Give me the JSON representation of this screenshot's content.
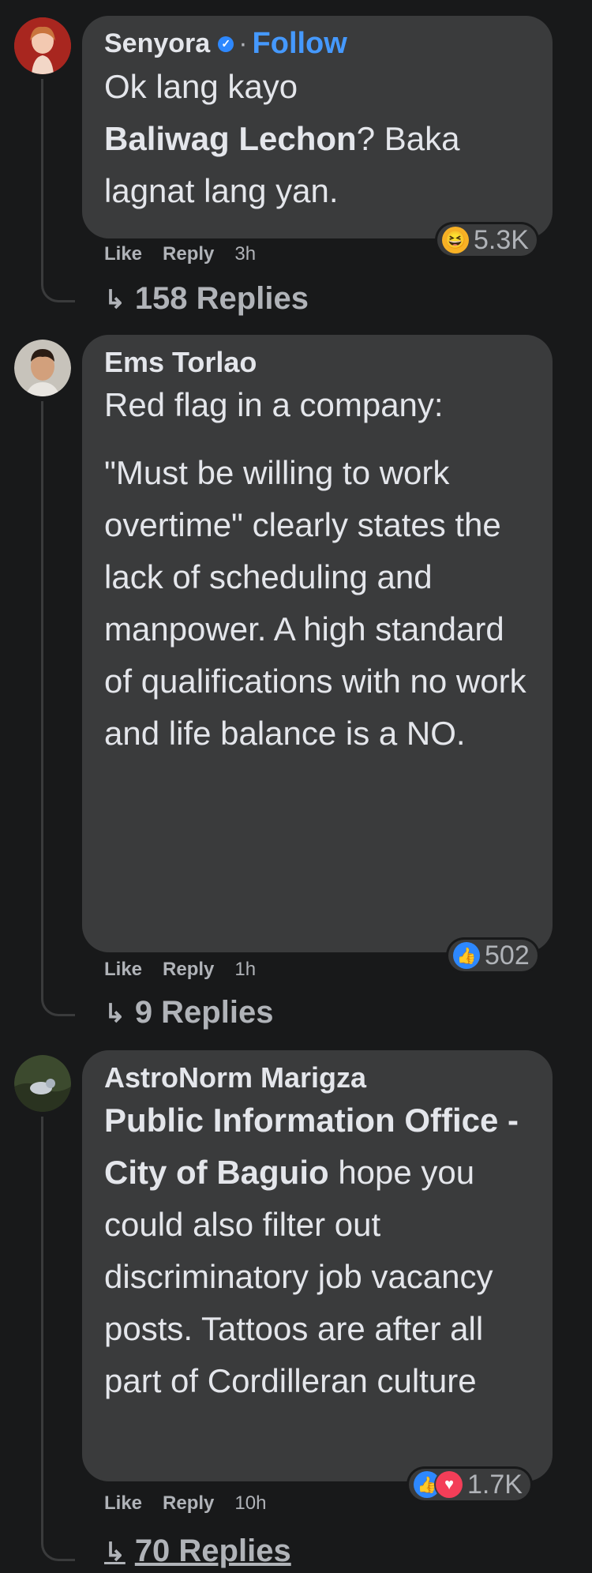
{
  "comments": [
    {
      "name": "Senyora",
      "verified": true,
      "follow": "Follow",
      "dot": "·",
      "text_line1": "Ok lang kayo",
      "text_bold": "Baliwag Lechon",
      "text_line2_rest": "? Baka",
      "text_line3": "lagnat lang yan.",
      "actions": {
        "like": "Like",
        "reply": "Reply",
        "time": "3h"
      },
      "reactions": {
        "icons": [
          "haha-icon"
        ],
        "count": "5.3K"
      },
      "replies": "158 Replies"
    },
    {
      "name": "Ems Torlao",
      "text_p1": "Red flag in a company:",
      "text_p2": "\"Must be willing to work overtime\" clearly states the lack of scheduling and manpower. A high standard of qualifications with no work and life balance is a NO.",
      "actions": {
        "like": "Like",
        "reply": "Reply",
        "time": "1h"
      },
      "reactions": {
        "icons": [
          "like-icon"
        ],
        "count": "502"
      },
      "replies": "9 Replies"
    },
    {
      "name": "AstroNorm Marigza",
      "mention": "Public Information Office - City of Baguio",
      "text": "hope you could also filter out discriminatory job vacancy posts. Tattoos are after all part of Cordilleran culture",
      "actions": {
        "like": "Like",
        "reply": "Reply",
        "time": "10h"
      },
      "reactions": {
        "icons": [
          "like-icon",
          "heart-icon"
        ],
        "count": "1.7K"
      },
      "replies": "70 Replies"
    }
  ],
  "colors": {
    "background": "#18191a",
    "bubble": "#3a3b3c",
    "follow": "#4599ff",
    "like": "#2d88ff",
    "heart": "#f33e58",
    "haha": "#f7b125"
  }
}
